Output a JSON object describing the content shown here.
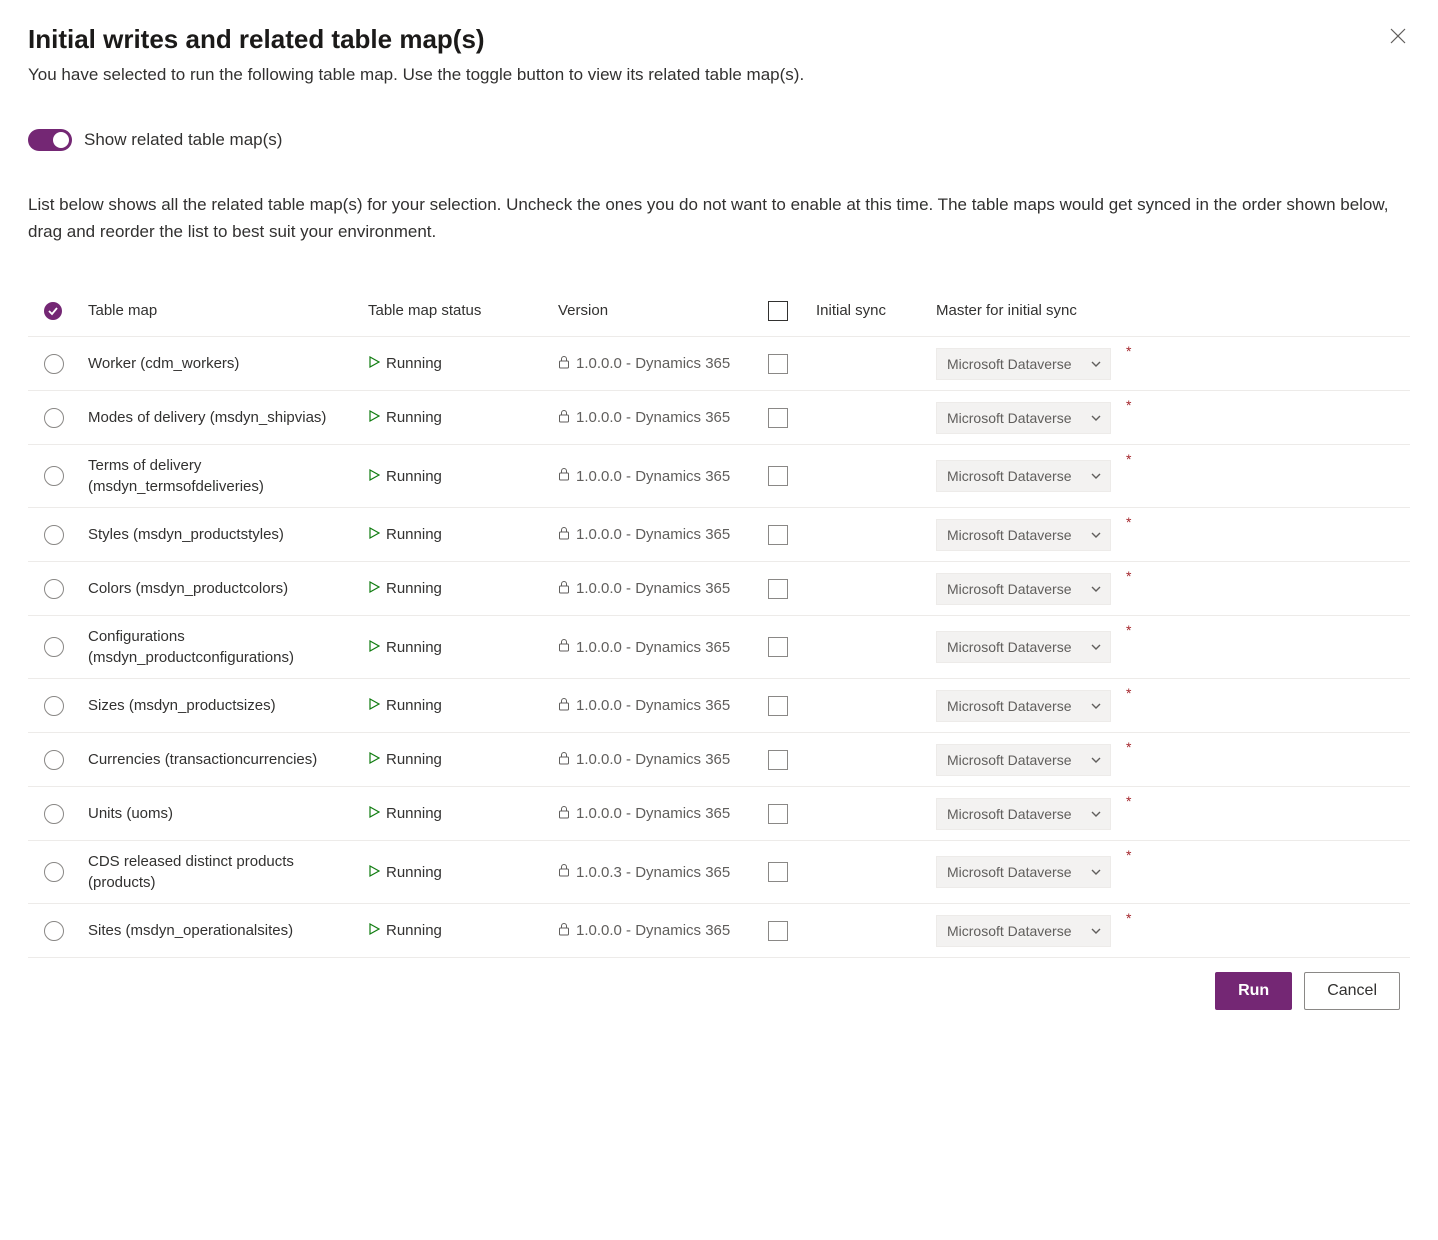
{
  "dialog": {
    "title": "Initial writes and related table map(s)",
    "subtitle": "You have selected to run the following table map. Use the toggle button to view its related table map(s).",
    "toggle_label": "Show related table map(s)",
    "description": "List below shows all the related table map(s) for your selection. Uncheck the ones you do not want to enable at this time. The table maps would get synced in the order shown below, drag and reorder the list to best suit your environment."
  },
  "columns": {
    "name": "Table map",
    "status": "Table map status",
    "version": "Version",
    "initial_sync": "Initial sync",
    "master": "Master for initial sync"
  },
  "rows": [
    {
      "name": "Worker (cdm_workers)",
      "status": "Running",
      "version": "1.0.0.0 - Dynamics 365",
      "master": "Microsoft Dataverse"
    },
    {
      "name": "Modes of delivery (msdyn_shipvias)",
      "status": "Running",
      "version": "1.0.0.0 - Dynamics 365",
      "master": "Microsoft Dataverse"
    },
    {
      "name": "Terms of delivery (msdyn_termsofdeliveries)",
      "status": "Running",
      "version": "1.0.0.0 - Dynamics 365",
      "master": "Microsoft Dataverse"
    },
    {
      "name": "Styles (msdyn_productstyles)",
      "status": "Running",
      "version": "1.0.0.0 - Dynamics 365",
      "master": "Microsoft Dataverse"
    },
    {
      "name": "Colors (msdyn_productcolors)",
      "status": "Running",
      "version": "1.0.0.0 - Dynamics 365",
      "master": "Microsoft Dataverse"
    },
    {
      "name": "Configurations (msdyn_productconfigurations)",
      "status": "Running",
      "version": "1.0.0.0 - Dynamics 365",
      "master": "Microsoft Dataverse"
    },
    {
      "name": "Sizes (msdyn_productsizes)",
      "status": "Running",
      "version": "1.0.0.0 - Dynamics 365",
      "master": "Microsoft Dataverse"
    },
    {
      "name": "Currencies (transactioncurrencies)",
      "status": "Running",
      "version": "1.0.0.0 - Dynamics 365",
      "master": "Microsoft Dataverse"
    },
    {
      "name": "Units (uoms)",
      "status": "Running",
      "version": "1.0.0.0 - Dynamics 365",
      "master": "Microsoft Dataverse"
    },
    {
      "name": "CDS released distinct products (products)",
      "status": "Running",
      "version": "1.0.0.3 - Dynamics 365",
      "master": "Microsoft Dataverse"
    },
    {
      "name": "Sites (msdyn_operationalsites)",
      "status": "Running",
      "version": "1.0.0.0 - Dynamics 365",
      "master": "Microsoft Dataverse"
    }
  ],
  "footer": {
    "run": "Run",
    "cancel": "Cancel"
  }
}
